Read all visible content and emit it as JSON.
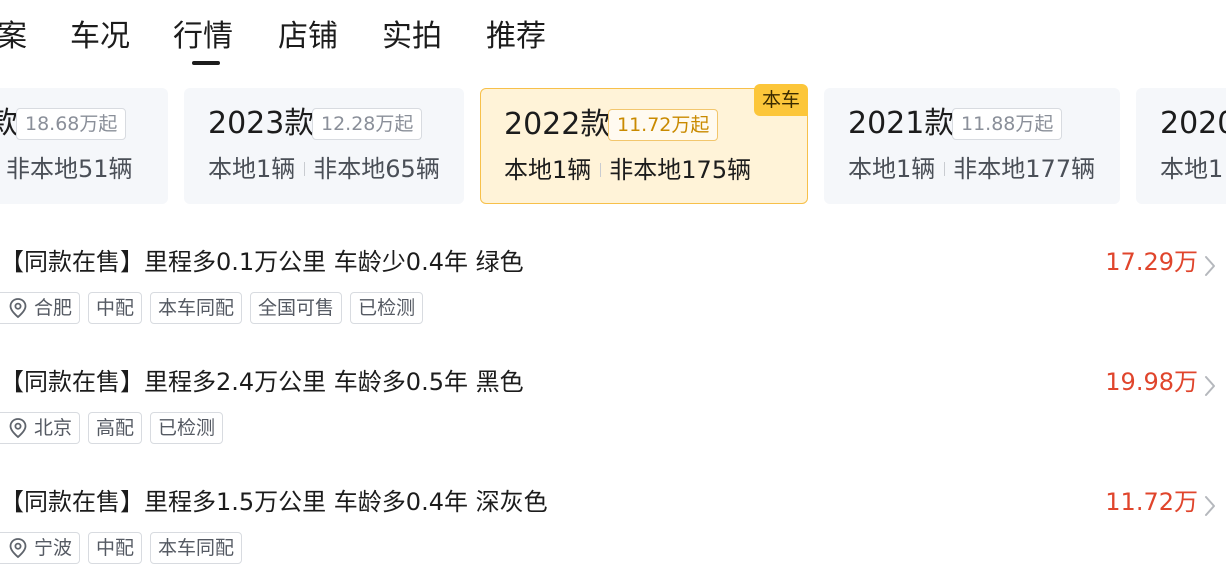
{
  "tabs": [
    {
      "label": "案"
    },
    {
      "label": "车况"
    },
    {
      "label": "行情"
    },
    {
      "label": "店铺"
    },
    {
      "label": "实拍"
    },
    {
      "label": "推荐"
    }
  ],
  "active_tab": "行情",
  "cards": [
    {
      "year": "款",
      "price": "18.68万起",
      "local": "",
      "nonlocal": "非本地51辆"
    },
    {
      "year": "2023款",
      "price": "12.28万起",
      "local": "本地1辆",
      "nonlocal": "非本地65辆"
    },
    {
      "year": "2022款",
      "price": "11.72万起",
      "local": "本地1辆",
      "nonlocal": "非本地175辆",
      "badge": "本车"
    },
    {
      "year": "2021款",
      "price": "11.88万起",
      "local": "本地1辆",
      "nonlocal": "非本地177辆"
    },
    {
      "year": "2020",
      "local": "本地1"
    }
  ],
  "listings": [
    {
      "title": "【同款在售】里程多0.1万公里 车龄少0.4年 绿色",
      "price": "17.29万",
      "city": "合肥",
      "tags": [
        "中配",
        "本车同配",
        "全国可售",
        "已检测"
      ]
    },
    {
      "title": "【同款在售】里程多2.4万公里 车龄多0.5年 黑色",
      "price": "19.98万",
      "city": "北京",
      "tags": [
        "高配",
        "已检测"
      ]
    },
    {
      "title": "【同款在售】里程多1.5万公里 车龄多0.4年 深灰色",
      "price": "11.72万",
      "city": "宁波",
      "tags": [
        "中配",
        "本车同配"
      ]
    }
  ],
  "colors": {
    "price_red": "#e0452c",
    "selected_bg": "#fff3d8",
    "selected_border": "#f7c04a",
    "badge_yellow": "#fcc63a",
    "card_bg": "#f5f7fa"
  },
  "icons": {
    "location": "location-pin-icon",
    "chevron": "chevron-right-icon"
  }
}
